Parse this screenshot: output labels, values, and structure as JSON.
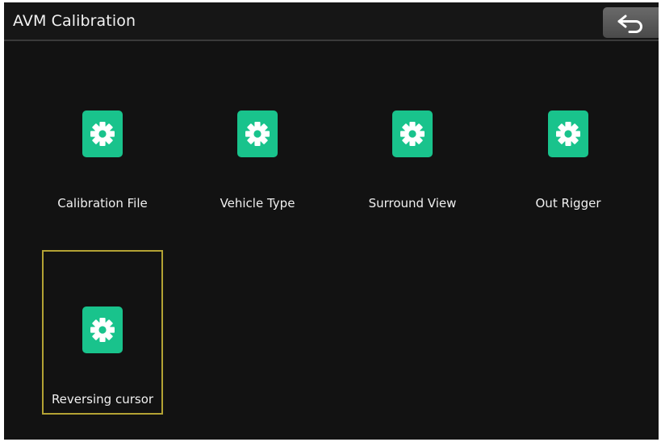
{
  "header": {
    "title": "AVM Calibration",
    "back_icon": "back-arrow-icon"
  },
  "menu": {
    "icon": "gear-icon",
    "accent_color": "#19c38c",
    "selection_color": "#b3a234",
    "items": [
      {
        "label": "Calibration File"
      },
      {
        "label": "Vehicle Type"
      },
      {
        "label": "Surround View"
      },
      {
        "label": "Out Rigger"
      },
      {
        "label": "Reversing cursor",
        "selected": true
      }
    ]
  }
}
